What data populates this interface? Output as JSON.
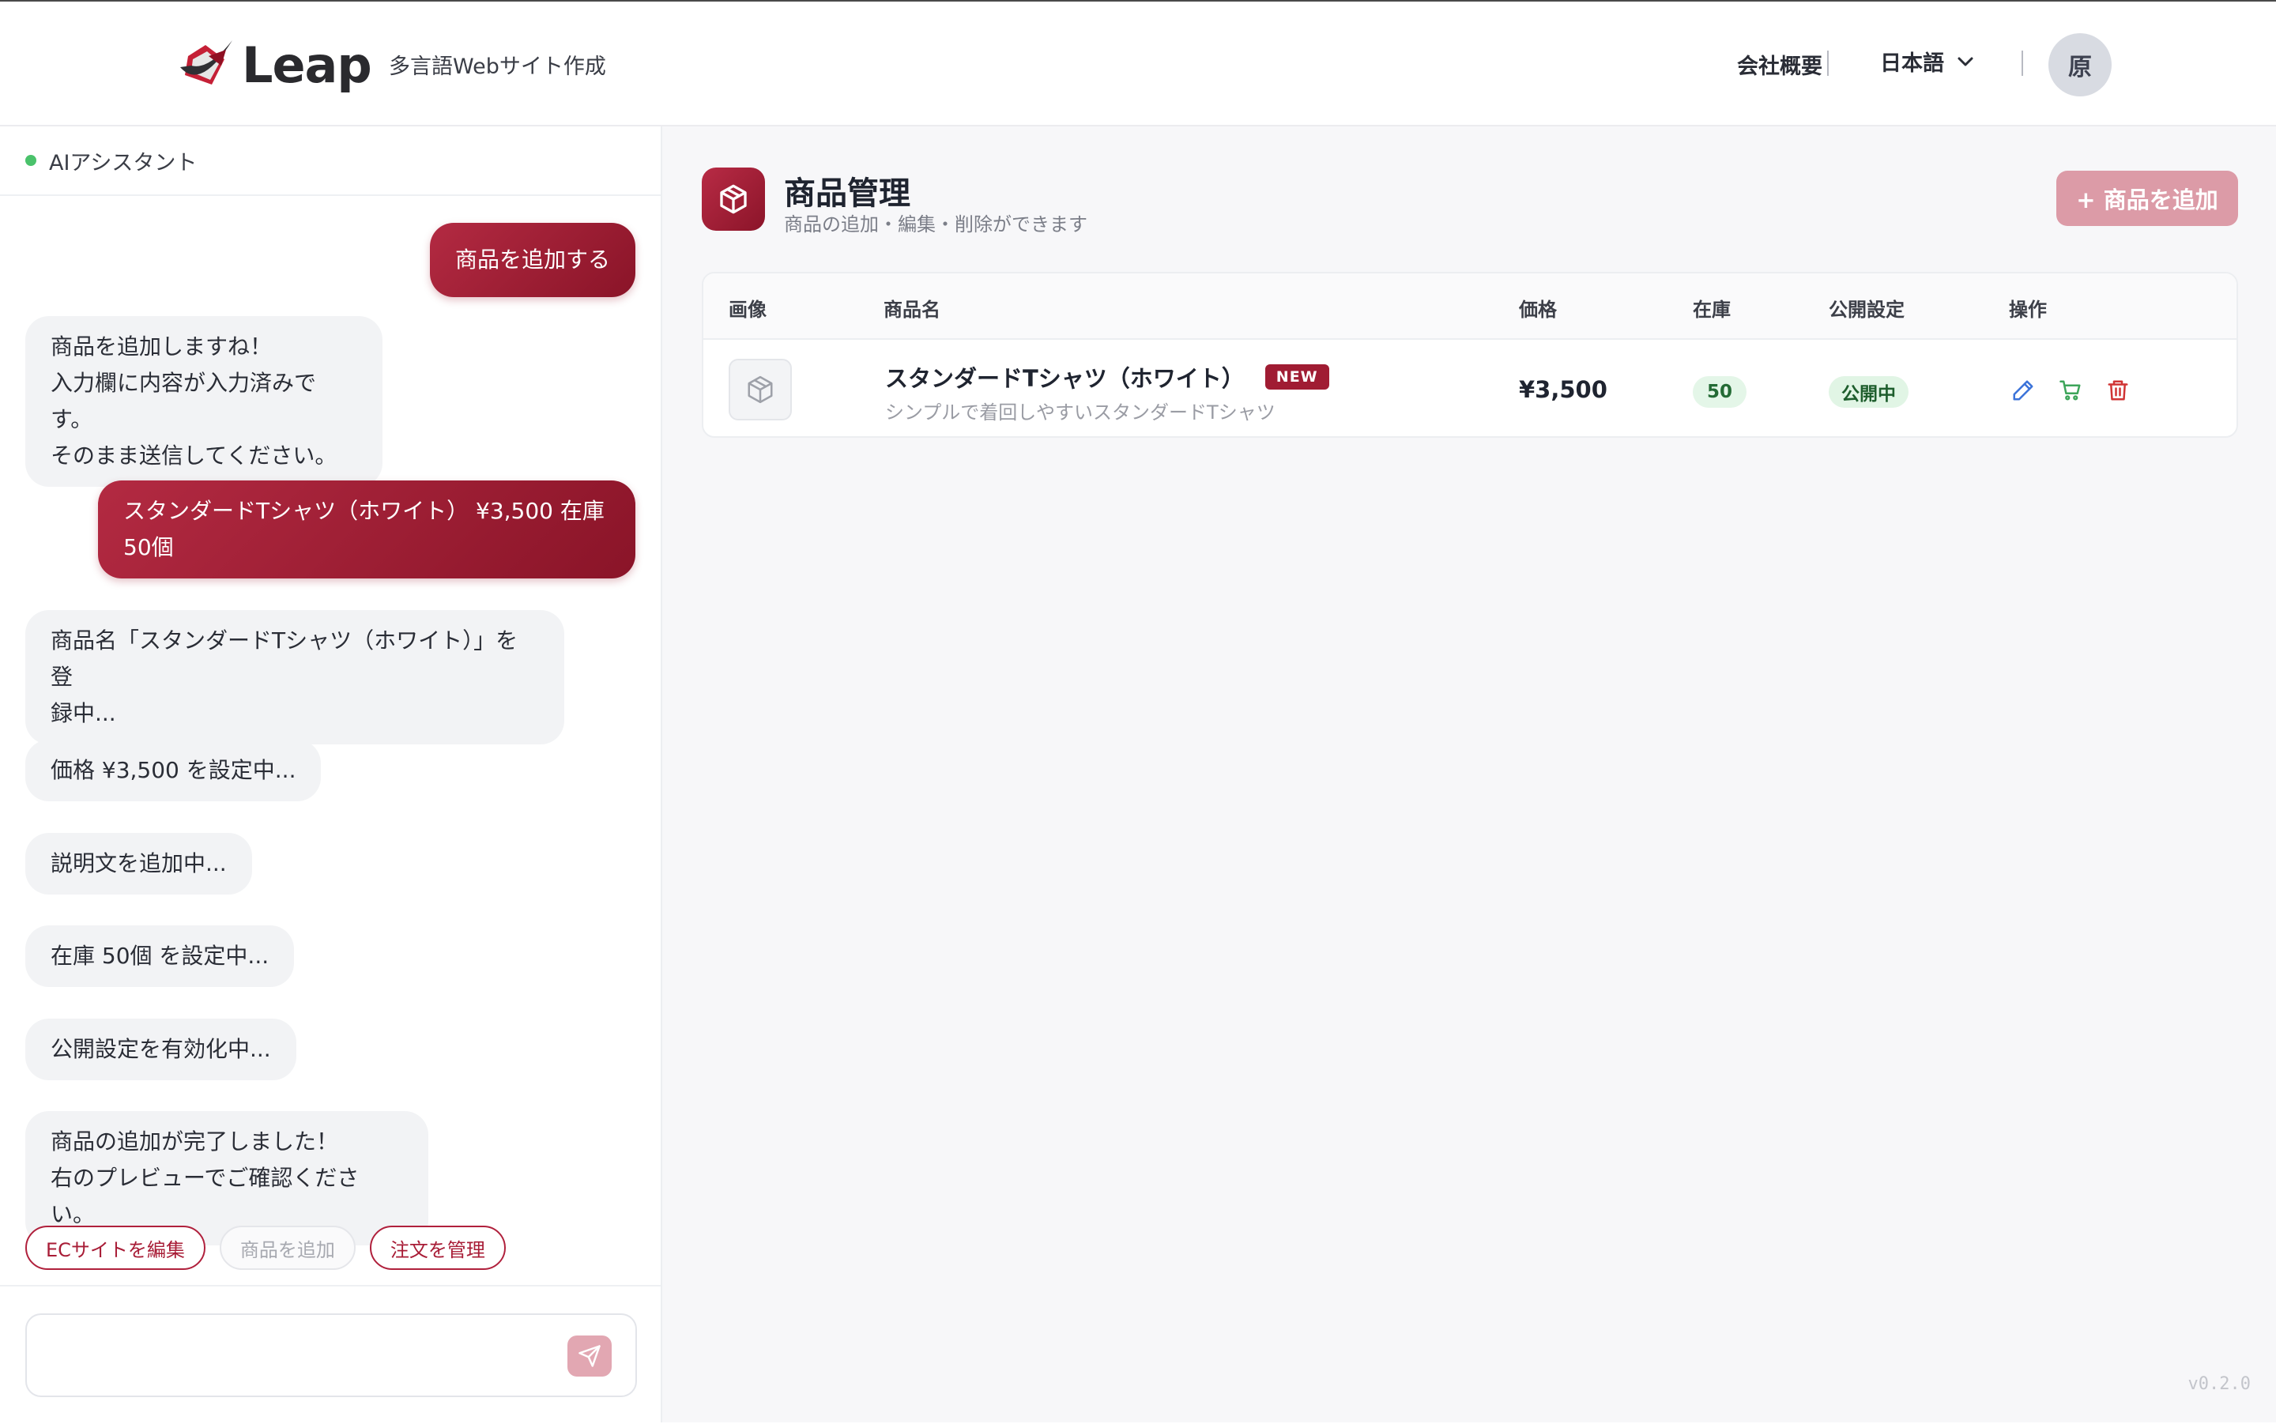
{
  "header": {
    "brand": "Leap",
    "tagline": "多言語Webサイト作成",
    "company_link": "会社概要",
    "language": "日本語",
    "avatar_initial": "原"
  },
  "chat": {
    "title": "AIアシスタント",
    "messages": [
      {
        "role": "user",
        "text": "商品を追加する"
      },
      {
        "role": "assistant",
        "lines": [
          "商品を追加しますね！",
          "入力欄に内容が入力済みです。",
          "そのまま送信してください。"
        ]
      },
      {
        "role": "user",
        "lines": [
          "スタンダードTシャツ（ホワイト） ¥3,500 在庫",
          "50個"
        ]
      },
      {
        "role": "assistant",
        "lines": [
          "商品名「スタンダードTシャツ（ホワイト）」を登",
          "録中..."
        ]
      },
      {
        "role": "assistant",
        "text": "価格 ¥3,500 を設定中..."
      },
      {
        "role": "assistant",
        "text": "説明文を追加中..."
      },
      {
        "role": "assistant",
        "text": "在庫 50個 を設定中..."
      },
      {
        "role": "assistant",
        "text": "公開設定を有効化中..."
      },
      {
        "role": "assistant",
        "lines": [
          "商品の追加が完了しました！",
          "右のプレビューでご確認ください。"
        ]
      }
    ],
    "quick_actions": [
      {
        "label": "ECサイトを編集",
        "state": "active"
      },
      {
        "label": "商品を追加",
        "state": "disabled"
      },
      {
        "label": "注文を管理",
        "state": "active"
      }
    ],
    "input_value": ""
  },
  "main": {
    "title": "商品管理",
    "subtitle": "商品の追加・編集・削除ができます",
    "add_button": "+ 商品を追加",
    "table": {
      "columns": [
        "画像",
        "商品名",
        "価格",
        "在庫",
        "公開設定",
        "操作"
      ],
      "rows": [
        {
          "name": "スタンダードTシャツ（ホワイト）",
          "badge": "NEW",
          "description": "シンプルで着回しやすいスタンダードTシャツ",
          "price": "¥3,500",
          "stock": "50",
          "status": "公開中"
        }
      ]
    }
  },
  "version": "v0.2.0",
  "colors": {
    "accent": "#a01c33",
    "accent_light": "#dc9ba7",
    "status_green": "#4ac26b",
    "edit_blue": "#3b73d9",
    "cart_green": "#3da55a",
    "delete_red": "#d03434"
  }
}
